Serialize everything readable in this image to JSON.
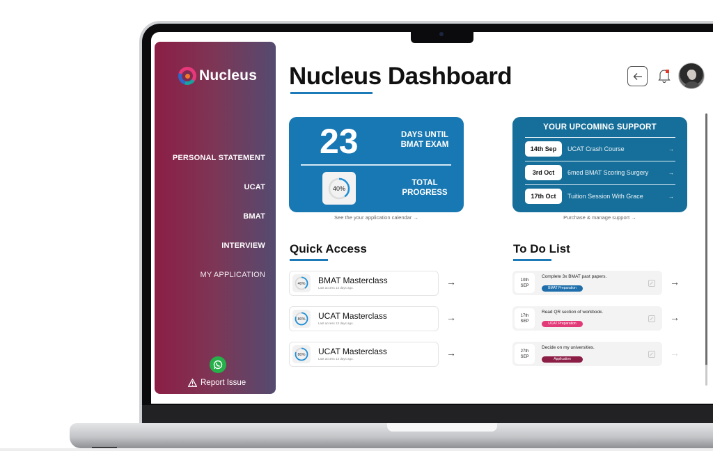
{
  "brand": {
    "name": "Nucleus",
    "colors": {
      "sidebar_start": "#8c1e45",
      "sidebar_end": "#544b70",
      "primary_blue": "#1878b3",
      "support_blue": "#166f9a",
      "whatsapp_green": "#25b04a",
      "tag_bmat": "#1d6eab",
      "tag_ucat": "#e23a78",
      "tag_application": "#8c1e45"
    }
  },
  "sidebar": {
    "logo_text": "Nucleus",
    "items": [
      {
        "label": "PERSONAL STATEMENT"
      },
      {
        "label": "UCAT"
      },
      {
        "label": "BMAT"
      },
      {
        "label": "INTERVIEW"
      },
      {
        "label": "MY APPLICATION"
      }
    ],
    "whatsapp_icon": "whatsapp-icon",
    "report_label": "Report Issue"
  },
  "header": {
    "title": "Nucleus Dashboard",
    "back_icon": "arrow-left-icon",
    "bell_icon": "bell-icon",
    "has_notification": true
  },
  "exam_card": {
    "days": "23",
    "days_label": "DAYS UNTIL BMAT EXAM",
    "progress_percent": 40,
    "progress_text": "40%",
    "progress_label": "TOTAL PROGRESS",
    "link": "See the your application calendar →"
  },
  "support_card": {
    "title": "YOUR UPCOMING SUPPORT",
    "sessions": [
      {
        "date": "14th Sep",
        "name": "UCAT Crash Course"
      },
      {
        "date": "3rd Oct",
        "name": "6med BMAT Scoring Surgery"
      },
      {
        "date": "17th Oct",
        "name": "Tuition Session With Grace"
      }
    ],
    "link": "Purchase & manage support →"
  },
  "quick_access": {
    "title": "Quick Access",
    "items": [
      {
        "name": "BMAT Masterclass",
        "progress_percent": 40,
        "progress_text": "40%",
        "subtitle": "Last access 13 days ago."
      },
      {
        "name": "UCAT Masterclass",
        "progress_percent": 80,
        "progress_text": "80%",
        "subtitle": "Last access 13 days ago."
      },
      {
        "name": "UCAT Masterclass",
        "progress_percent": 80,
        "progress_text": "80%",
        "subtitle": "Last access 13 days ago."
      }
    ]
  },
  "todo": {
    "title": "To Do List",
    "items": [
      {
        "day": "10th",
        "month": "SEP",
        "text": "Complete 3x BMAT past papers.",
        "tag": "BMAT Preparation",
        "tag_color": "#1d6eab",
        "arrow_enabled": true
      },
      {
        "day": "17th",
        "month": "SEP",
        "text": "Read QR section of workbook.",
        "tag": "UCAT Preparation",
        "tag_color": "#e23a78",
        "arrow_enabled": true
      },
      {
        "day": "27th",
        "month": "SEP",
        "text": "Decide on my universities.",
        "tag": "Application",
        "tag_color": "#8c1e45",
        "arrow_enabled": false
      }
    ]
  }
}
